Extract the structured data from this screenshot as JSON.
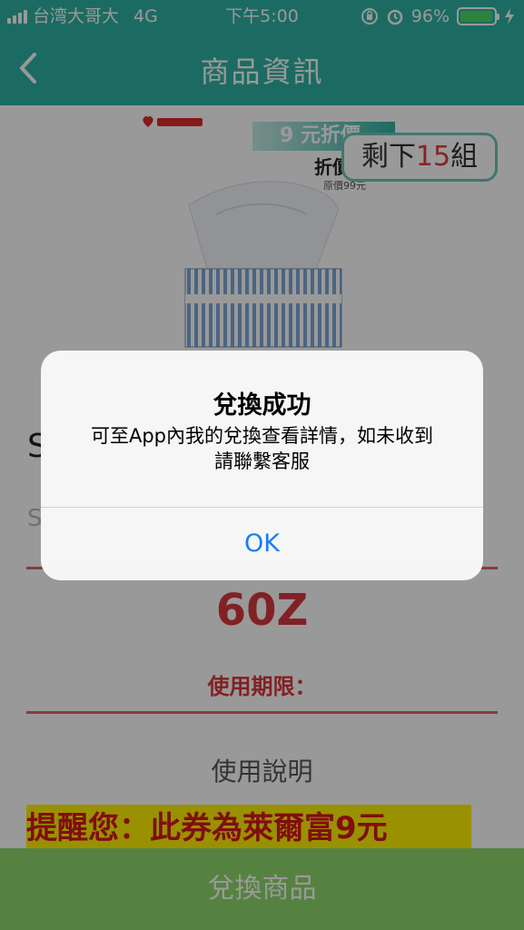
{
  "status_bar": {
    "carrier": "台湾大哥大",
    "network": "4G",
    "time": "下午5:00",
    "battery_percent": "96%",
    "battery_level": 0.96
  },
  "nav": {
    "title": "商品資訊"
  },
  "product": {
    "promo_banner": "9 元折價",
    "promo_sub": "折價",
    "promo_small": "原價99元",
    "remaining_prefix": "剩下",
    "remaining_count": "15",
    "remaining_suffix": "組",
    "title_partial": "S",
    "subtitle_partial": "S"
  },
  "coupon": {
    "points": "60Z",
    "expiry_label": "使用期限："
  },
  "usage": {
    "title": "使用說明",
    "reminder": "提醒您：此券為萊爾富9元"
  },
  "bottom": {
    "redeem_label": "兌換商品"
  },
  "alert": {
    "title": "兌換成功",
    "message_line1": "可至App內我的兌換查看詳情，如未收到",
    "message_line2": "請聯繫客服",
    "ok_label": "OK"
  },
  "colors": {
    "teal": "#2fb3a4",
    "accent_red": "#d9383e",
    "ios_blue": "#1a7cf5",
    "redeem_green": "#8ed96b"
  }
}
